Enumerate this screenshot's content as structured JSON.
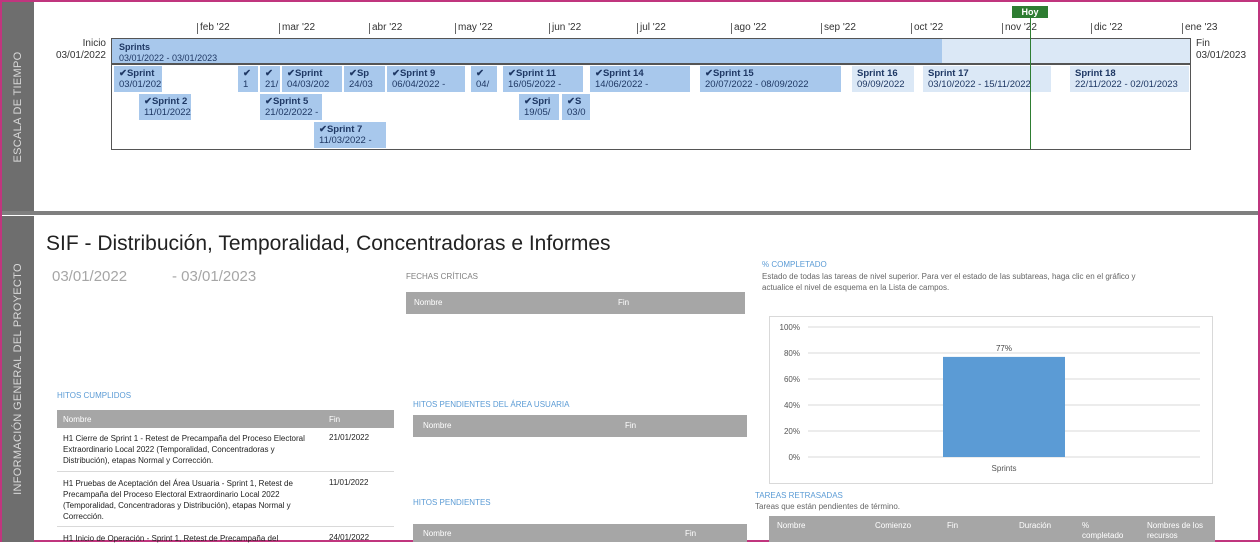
{
  "sidebar": {
    "timeline_label": "ESCALA DE TIEMPO",
    "project_label": "INFORMACIÓN GENERAL DEL PROYECTO"
  },
  "timeline": {
    "today_label": "Hoy",
    "start_label": "Inicio",
    "start_date": "03/01/2022",
    "end_label": "Fin",
    "end_date": "03/01/2023",
    "months": [
      "feb '22",
      "mar '22",
      "abr '22",
      "may '22",
      "jun '22",
      "jul '22",
      "ago '22",
      "sep '22",
      "oct '22",
      "nov '22",
      "dic '22",
      "ene '23"
    ],
    "summary_title": "Sprints",
    "summary_dates": "03/01/2022 - 03/01/2023",
    "tasks": [
      {
        "title": "✔Sprint",
        "dates": "03/01/202"
      },
      {
        "title": "✔",
        "dates": "1"
      },
      {
        "title": "✔",
        "dates": "21/"
      },
      {
        "title": "✔Sprint",
        "dates": "04/03/202"
      },
      {
        "title": "✔Sp",
        "dates": "24/03"
      },
      {
        "title": "✔Sprint 9",
        "dates": "06/04/2022 -"
      },
      {
        "title": "✔",
        "dates": "04/"
      },
      {
        "title": "✔Sprint 11",
        "dates": "16/05/2022 -"
      },
      {
        "title": "✔Sprint 14",
        "dates": "14/06/2022 -"
      },
      {
        "title": "✔Sprint 15",
        "dates": "20/07/2022 - 08/09/2022"
      },
      {
        "title": "Sprint 16",
        "dates": "09/09/2022"
      },
      {
        "title": "Sprint 17",
        "dates": "03/10/2022 - 15/11/2022"
      },
      {
        "title": "Sprint 18",
        "dates": "22/11/2022 - 02/01/2023"
      },
      {
        "title": "✔Sprint 2",
        "dates": "11/01/2022 -"
      },
      {
        "title": "✔Sprint 5",
        "dates": "21/02/2022 -"
      },
      {
        "title": "✔Spri",
        "dates": "19/05/"
      },
      {
        "title": "✔S",
        "dates": "03/0"
      },
      {
        "title": "✔Sprint 7",
        "dates": "11/03/2022 -"
      }
    ]
  },
  "project": {
    "title": "SIF - Distribución, Temporalidad, Concentradoras  e Informes",
    "start": "03/01/2022",
    "end": "- 03/01/2023"
  },
  "critical_dates": {
    "heading": "FECHAS CRÍTICAS",
    "col_name": "Nombre",
    "col_end": "Fin"
  },
  "completed_milestones": {
    "heading": "HITOS CUMPLIDOS",
    "col_name": "Nombre",
    "col_end": "Fin",
    "rows": [
      {
        "name": "H1 Cierre de Sprint 1 - Retest de Precampaña del Proceso Electoral Extraordinario Local 2022 (Temporalidad, Concentradoras y Distribución), etapas Normal y Corrección.",
        "end": "21/01/2022"
      },
      {
        "name": "H1 Pruebas de Aceptación del Área Usuaria - Sprint 1, Retest de Precampaña del Proceso Electoral Extraordinario Local 2022 (Temporalidad, Concentradoras y Distribución), etapas Normal y Corrección.",
        "end": "11/01/2022"
      },
      {
        "name": "H1 Inicio de Operación - Sprint 1, Retest de Precampaña del",
        "end": "24/01/2022"
      }
    ]
  },
  "user_pending": {
    "heading": "HITOS PENDIENTES DEL ÁREA USUARIA",
    "col_name": "Nombre",
    "col_end": "Fin"
  },
  "pending": {
    "heading": "HITOS PENDIENTES",
    "col_name": "Nombre",
    "col_end": "Fin"
  },
  "completion": {
    "heading": "% COMPLETADO",
    "description": "Estado de todas las tareas de nivel superior. Para ver el estado de las subtareas, haga clic en el gráfico y actualice el nivel de esquema en la Lista de campos."
  },
  "chart_data": {
    "type": "bar",
    "categories": [
      "Sprints"
    ],
    "values": [
      77
    ],
    "value_labels": [
      "77%"
    ],
    "ylim": [
      0,
      100
    ],
    "y_ticks": [
      "0%",
      "20%",
      "40%",
      "60%",
      "80%",
      "100%"
    ],
    "grid": true,
    "bar_color": "#5b9bd5"
  },
  "late_tasks": {
    "heading": "TAREAS RETRASADAS",
    "description": "Tareas que están pendientes de término.",
    "columns": [
      "Nombre",
      "Comienzo",
      "Fin",
      "Duración",
      "% completado",
      "Nombres de los recursos"
    ]
  },
  "colors": {
    "frame": "#c0357e",
    "today": "#2e7d32",
    "task_done": "#a8c8ec",
    "task_future": "#dbe8f6"
  }
}
